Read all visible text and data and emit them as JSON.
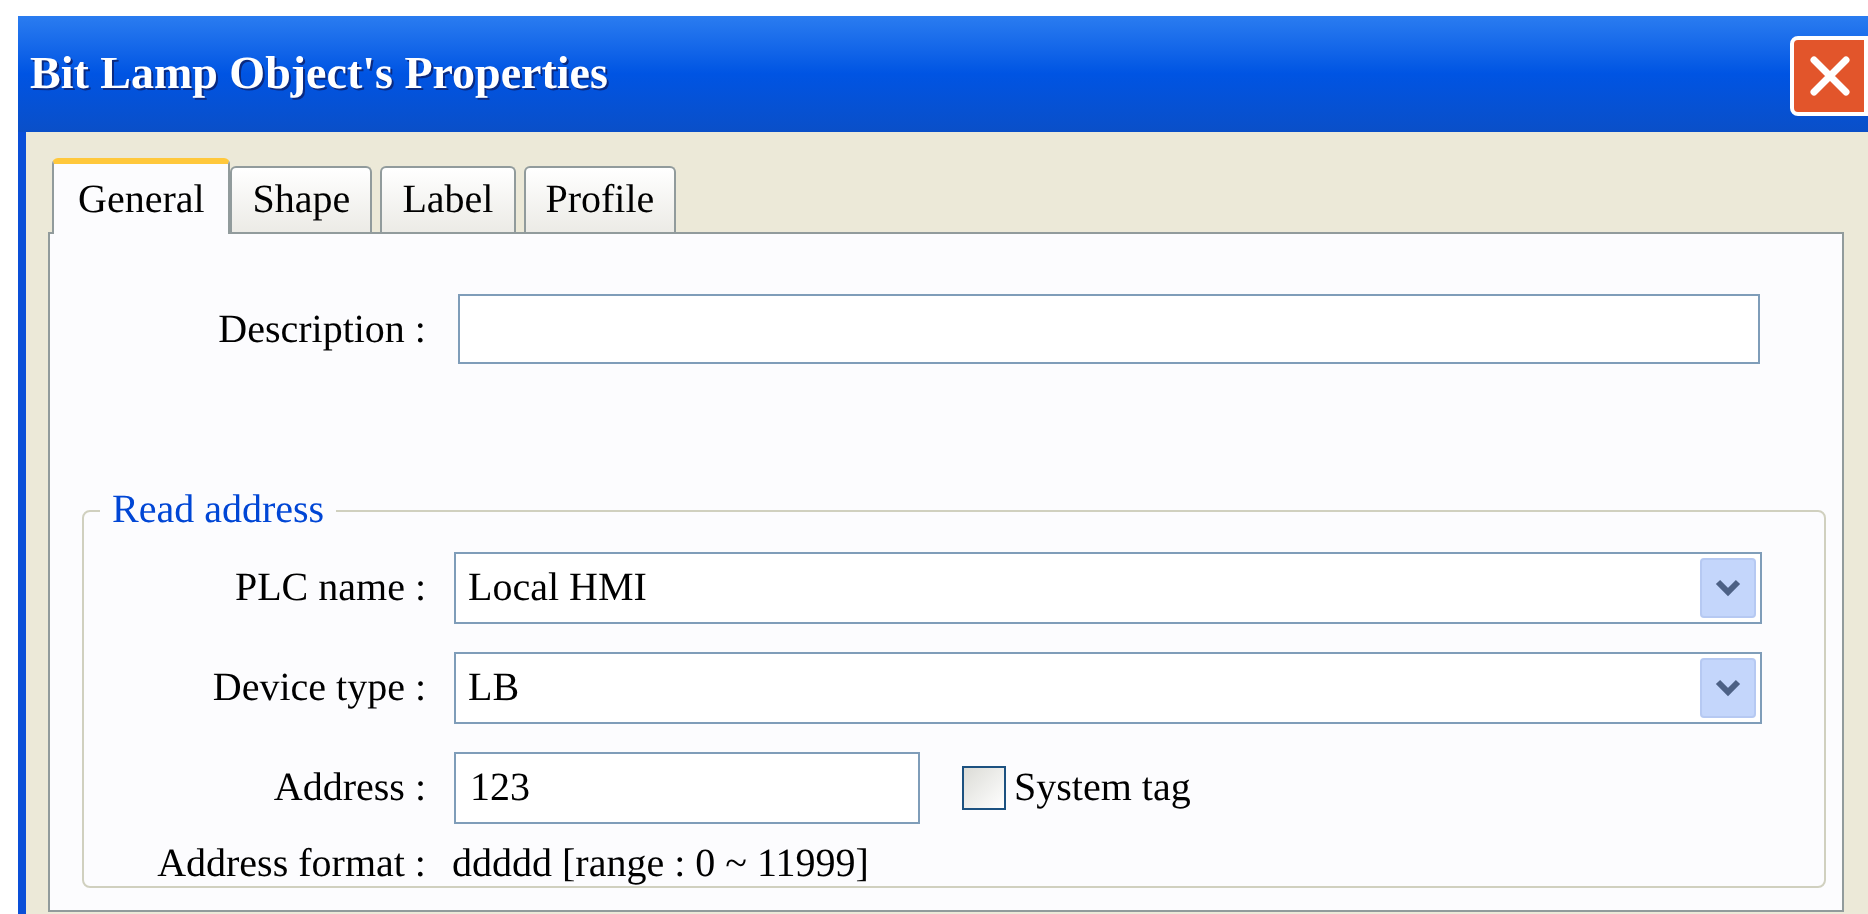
{
  "window": {
    "title": "Bit Lamp Object's Properties"
  },
  "tabs": [
    {
      "label": "General",
      "selected": true
    },
    {
      "label": "Shape",
      "selected": false
    },
    {
      "label": "Label",
      "selected": false
    },
    {
      "label": "Profile",
      "selected": false
    }
  ],
  "description": {
    "label": "Description :"
  },
  "read_address": {
    "title": "Read address",
    "rows": [
      {
        "kind": "dropdown",
        "label": "PLC name :",
        "value": "Local HMI"
      },
      {
        "kind": "dropdown",
        "label": "Device type :",
        "value": "LB"
      },
      {
        "kind": "address",
        "label": "Address :",
        "value": "123",
        "checkbox": {
          "label": "System tag",
          "checked": false
        }
      },
      {
        "kind": "info",
        "label": "Address format :",
        "value": "ddddd [range : 0 ~ 11999]"
      }
    ]
  }
}
